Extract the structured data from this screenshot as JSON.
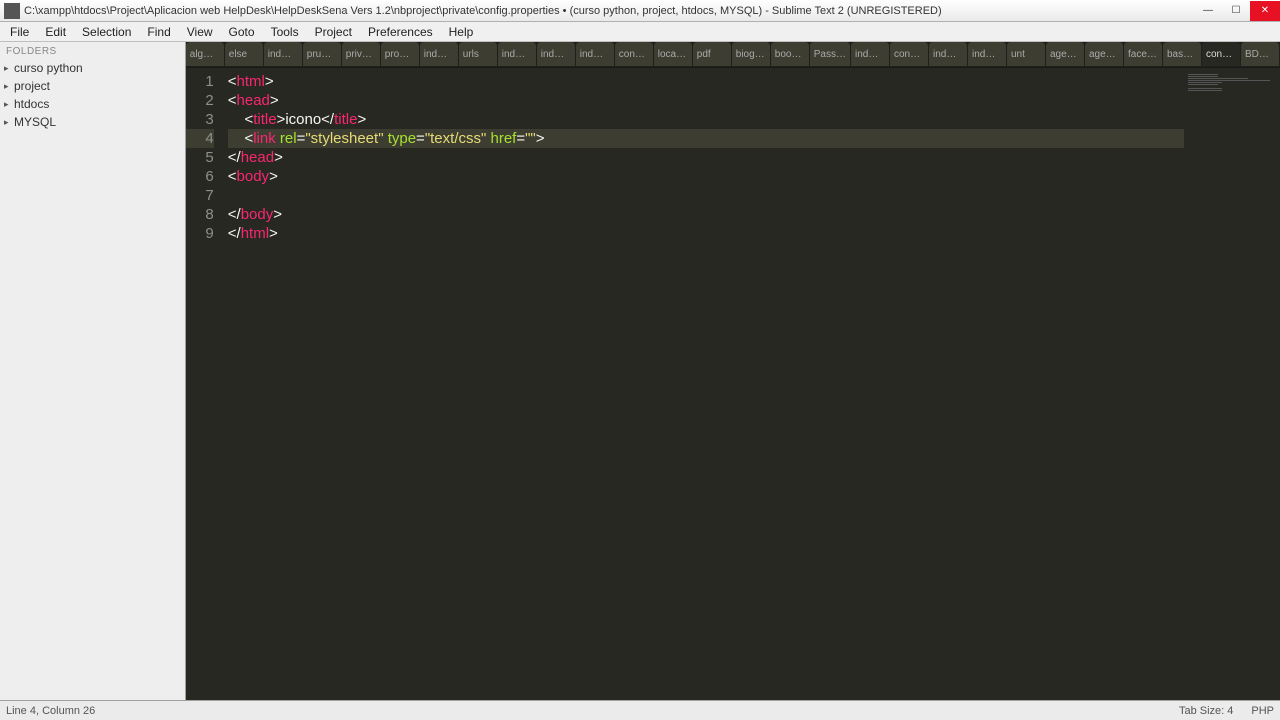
{
  "window": {
    "title": "C:\\xampp\\htdocs\\Project\\Aplicacion web HelpDesk\\HelpDeskSena Vers 1.2\\nbproject\\private\\config.properties • (curso python, project, htdocs, MYSQL) - Sublime Text 2 (UNREGISTERED)"
  },
  "menu": {
    "items": [
      "File",
      "Edit",
      "Selection",
      "Find",
      "View",
      "Goto",
      "Tools",
      "Project",
      "Preferences",
      "Help"
    ]
  },
  "sidebar": {
    "header": "FOLDERS",
    "items": [
      {
        "label": "curso python"
      },
      {
        "label": "project"
      },
      {
        "label": "htdocs"
      },
      {
        "label": "MYSQL"
      }
    ]
  },
  "tabs": {
    "items": [
      "alg…",
      "else",
      "ind…",
      "pru…",
      "priv…",
      "pro…",
      "ind…",
      "urls",
      "ind…",
      "ind…",
      "ind…",
      "con…",
      "loca…",
      "pdf",
      "biog…",
      "boo…",
      "Pass…",
      "ind…",
      "con…",
      "ind…",
      "ind…",
      "unt",
      "age…",
      "age…",
      "face…",
      "bas…",
      "con…",
      "BD…"
    ],
    "active_index": 26
  },
  "code": {
    "lines": [
      {
        "num": "1",
        "tokens": [
          [
            "angle",
            "<"
          ],
          [
            "tagname",
            "html"
          ],
          [
            "angle",
            ">"
          ]
        ]
      },
      {
        "num": "2",
        "tokens": [
          [
            "angle",
            "<"
          ],
          [
            "tagname",
            "head"
          ],
          [
            "angle",
            ">"
          ]
        ]
      },
      {
        "num": "3",
        "tokens": [
          [
            "plain",
            "    "
          ],
          [
            "angle",
            "<"
          ],
          [
            "tagname",
            "title"
          ],
          [
            "angle",
            ">"
          ],
          [
            "plain",
            "icono"
          ],
          [
            "angle",
            "</"
          ],
          [
            "tagname",
            "title"
          ],
          [
            "angle",
            ">"
          ]
        ]
      },
      {
        "num": "4",
        "tokens": [
          [
            "plain",
            "    "
          ],
          [
            "angle",
            "<"
          ],
          [
            "tagname",
            "link"
          ],
          [
            "plain",
            " "
          ],
          [
            "attr",
            "rel"
          ],
          [
            "angle",
            "="
          ],
          [
            "string",
            "\"stylesheet\""
          ],
          [
            "plain",
            " "
          ],
          [
            "attr",
            "type"
          ],
          [
            "angle",
            "="
          ],
          [
            "string",
            "\"text/css\""
          ],
          [
            "plain",
            " "
          ],
          [
            "attr",
            "href"
          ],
          [
            "angle",
            "="
          ],
          [
            "string",
            "\"\""
          ],
          [
            "angle",
            ">"
          ]
        ]
      },
      {
        "num": "5",
        "tokens": [
          [
            "angle",
            "</"
          ],
          [
            "tagname",
            "head"
          ],
          [
            "angle",
            ">"
          ]
        ]
      },
      {
        "num": "6",
        "tokens": [
          [
            "angle",
            "<"
          ],
          [
            "tagname",
            "body"
          ],
          [
            "angle",
            ">"
          ]
        ]
      },
      {
        "num": "7",
        "tokens": []
      },
      {
        "num": "8",
        "tokens": [
          [
            "angle",
            "</"
          ],
          [
            "tagname",
            "body"
          ],
          [
            "angle",
            ">"
          ]
        ]
      },
      {
        "num": "9",
        "tokens": [
          [
            "angle",
            "</"
          ],
          [
            "tagname",
            "html"
          ],
          [
            "angle",
            ">"
          ]
        ]
      }
    ],
    "active_line_index": 3
  },
  "status": {
    "left": "Line 4, Column 26",
    "tabsize": "Tab Size: 4",
    "lang": "PHP"
  }
}
